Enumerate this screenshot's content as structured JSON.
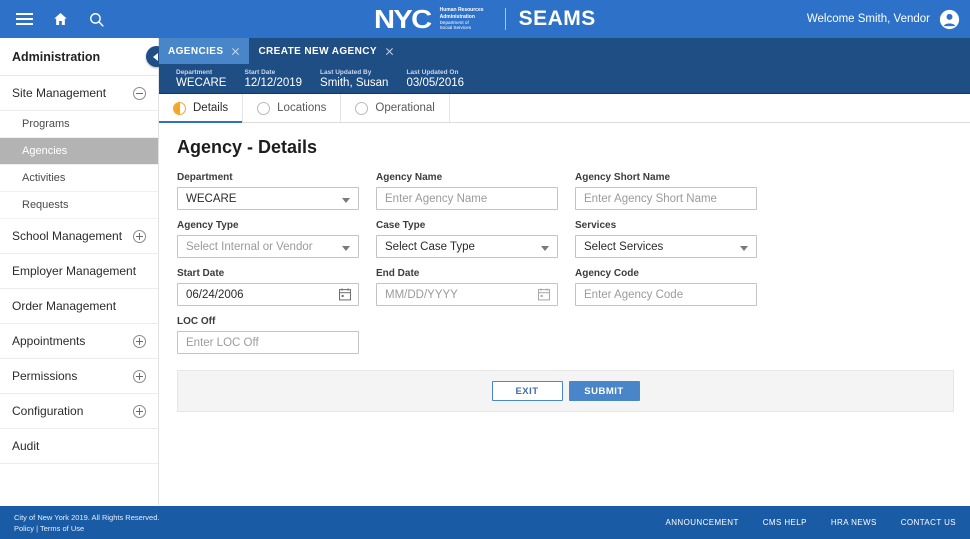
{
  "header": {
    "menu_icon": "hamburger-menu-icon",
    "home_icon": "home-icon",
    "search_icon": "search-icon",
    "logo_primary": "NYC",
    "logo_sub_line1": "Human Resources",
    "logo_sub_line2": "Administration",
    "logo_sub_line3": "Department of",
    "logo_sub_line4": "Social Services",
    "app_name": "SEAMS",
    "welcome": "Welcome Smith, Vendor",
    "avatar_icon": "user-avatar-icon",
    "bg_color": "#2d72c8"
  },
  "sidebar": {
    "title": "Administration",
    "collapse_icon": "chevron-left-icon",
    "items": [
      {
        "label": "Site Management",
        "toggle": "minus",
        "expanded": true
      },
      {
        "label": "Programs",
        "sub": true
      },
      {
        "label": "Agencies",
        "sub": true,
        "active": true
      },
      {
        "label": "Activities",
        "sub": true
      },
      {
        "label": "Requests",
        "sub": true
      },
      {
        "label": "School Management",
        "toggle": "plus"
      },
      {
        "label": "Employer Management",
        "toggle": "none"
      },
      {
        "label": "Order Management",
        "toggle": "none"
      },
      {
        "label": "Appointments",
        "toggle": "plus"
      },
      {
        "label": "Permissions",
        "toggle": "plus"
      },
      {
        "label": "Configuration",
        "toggle": "plus"
      },
      {
        "label": "Audit",
        "toggle": "none"
      }
    ]
  },
  "tabs": [
    {
      "label": "AGENCIES",
      "active": false
    },
    {
      "label": "CREATE NEW AGENCY",
      "active": true
    }
  ],
  "infobar": [
    {
      "label": "Department",
      "value": "WECARE"
    },
    {
      "label": "Start Date",
      "value": "12/12/2019"
    },
    {
      "label": "Last Updated By",
      "value": "Smith, Susan"
    },
    {
      "label": "Last Updated On",
      "value": "03/05/2016"
    }
  ],
  "steps": [
    {
      "label": "Details",
      "active": true,
      "icon": "half-filled-circle-icon"
    },
    {
      "label": "Locations",
      "active": false,
      "icon": "empty-circle-icon"
    },
    {
      "label": "Operational",
      "active": false,
      "icon": "empty-circle-icon"
    }
  ],
  "form": {
    "title": "Agency - Details",
    "department": {
      "label": "Department",
      "value": "WECARE",
      "placeholder": ""
    },
    "agency_name": {
      "label": "Agency Name",
      "value": "",
      "placeholder": "Enter Agency Name"
    },
    "agency_short_name": {
      "label": "Agency Short Name",
      "value": "",
      "placeholder": "Enter Agency Short Name"
    },
    "agency_type": {
      "label": "Agency Type",
      "value": "",
      "placeholder": "Select Internal or Vendor"
    },
    "case_type": {
      "label": "Case Type",
      "value": "Select Case Type",
      "placeholder": "Select Case Type"
    },
    "services": {
      "label": "Services",
      "value": "Select Services",
      "placeholder": "Select Services"
    },
    "start_date": {
      "label": "Start Date",
      "value": "06/24/2006",
      "placeholder": "MM/DD/YYYY"
    },
    "end_date": {
      "label": "End Date",
      "value": "",
      "placeholder": "MM/DD/YYYY"
    },
    "agency_code": {
      "label": "Agency Code",
      "value": "",
      "placeholder": "Enter Agency Code"
    },
    "loc_off": {
      "label": "LOC Off",
      "value": "",
      "placeholder": "Enter LOC Off"
    }
  },
  "actions": {
    "exit_label": "EXIT",
    "submit_label": "SUBMIT",
    "submit_color": "#4986c9"
  },
  "footer": {
    "copyright": "City of New York 2019. All Rights Reserved.",
    "policy": "Policy",
    "separator": "|",
    "terms": "Terms of Use",
    "links": [
      "ANNOUNCEMENT",
      "CMS HELP",
      "HRA NEWS",
      "CONTACT US"
    ],
    "bg_color": "#1a5ba6"
  }
}
